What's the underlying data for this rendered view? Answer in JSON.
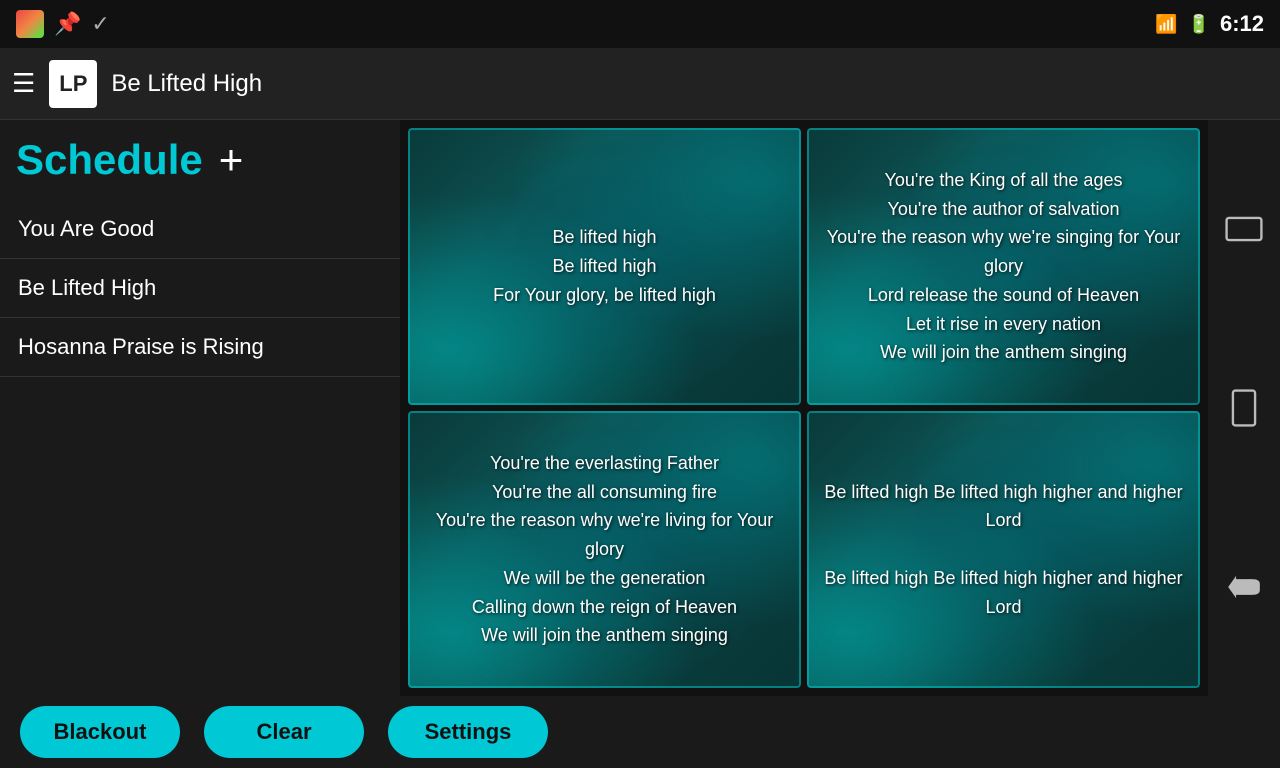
{
  "statusBar": {
    "time": "6:12"
  },
  "appBar": {
    "logo": "LP",
    "title": "Be Lifted High"
  },
  "sidebar": {
    "scheduleLabel": "Schedule",
    "addButton": "+",
    "items": [
      {
        "label": "You Are Good"
      },
      {
        "label": "Be Lifted High"
      },
      {
        "label": "Hosanna Praise is Rising"
      }
    ]
  },
  "cards": [
    {
      "id": "card1",
      "text": "Be lifted high\nBe lifted high\nFor Your glory, be lifted high",
      "selected": false
    },
    {
      "id": "card2",
      "text": "You're the King of all the ages\nYou're the author of salvation\nYou're the reason why we're singing for Your glory\nLord release the sound of Heaven\nLet it rise in every nation\nWe will join the anthem singing",
      "selected": false
    },
    {
      "id": "card3",
      "text": "You're the everlasting Father\nYou're the all consuming fire\nYou're the reason why we're living for Your glory\nWe will be the generation\nCalling down the reign of Heaven\nWe will join the anthem singing",
      "selected": false
    },
    {
      "id": "card4",
      "text": "Be lifted high Be lifted high higher and higher Lord\nBe lifted high Be lifted high higher and higher Lord",
      "selected": false
    }
  ],
  "bottomBar": {
    "blackout": "Blackout",
    "clear": "Clear",
    "settings": "Settings"
  }
}
